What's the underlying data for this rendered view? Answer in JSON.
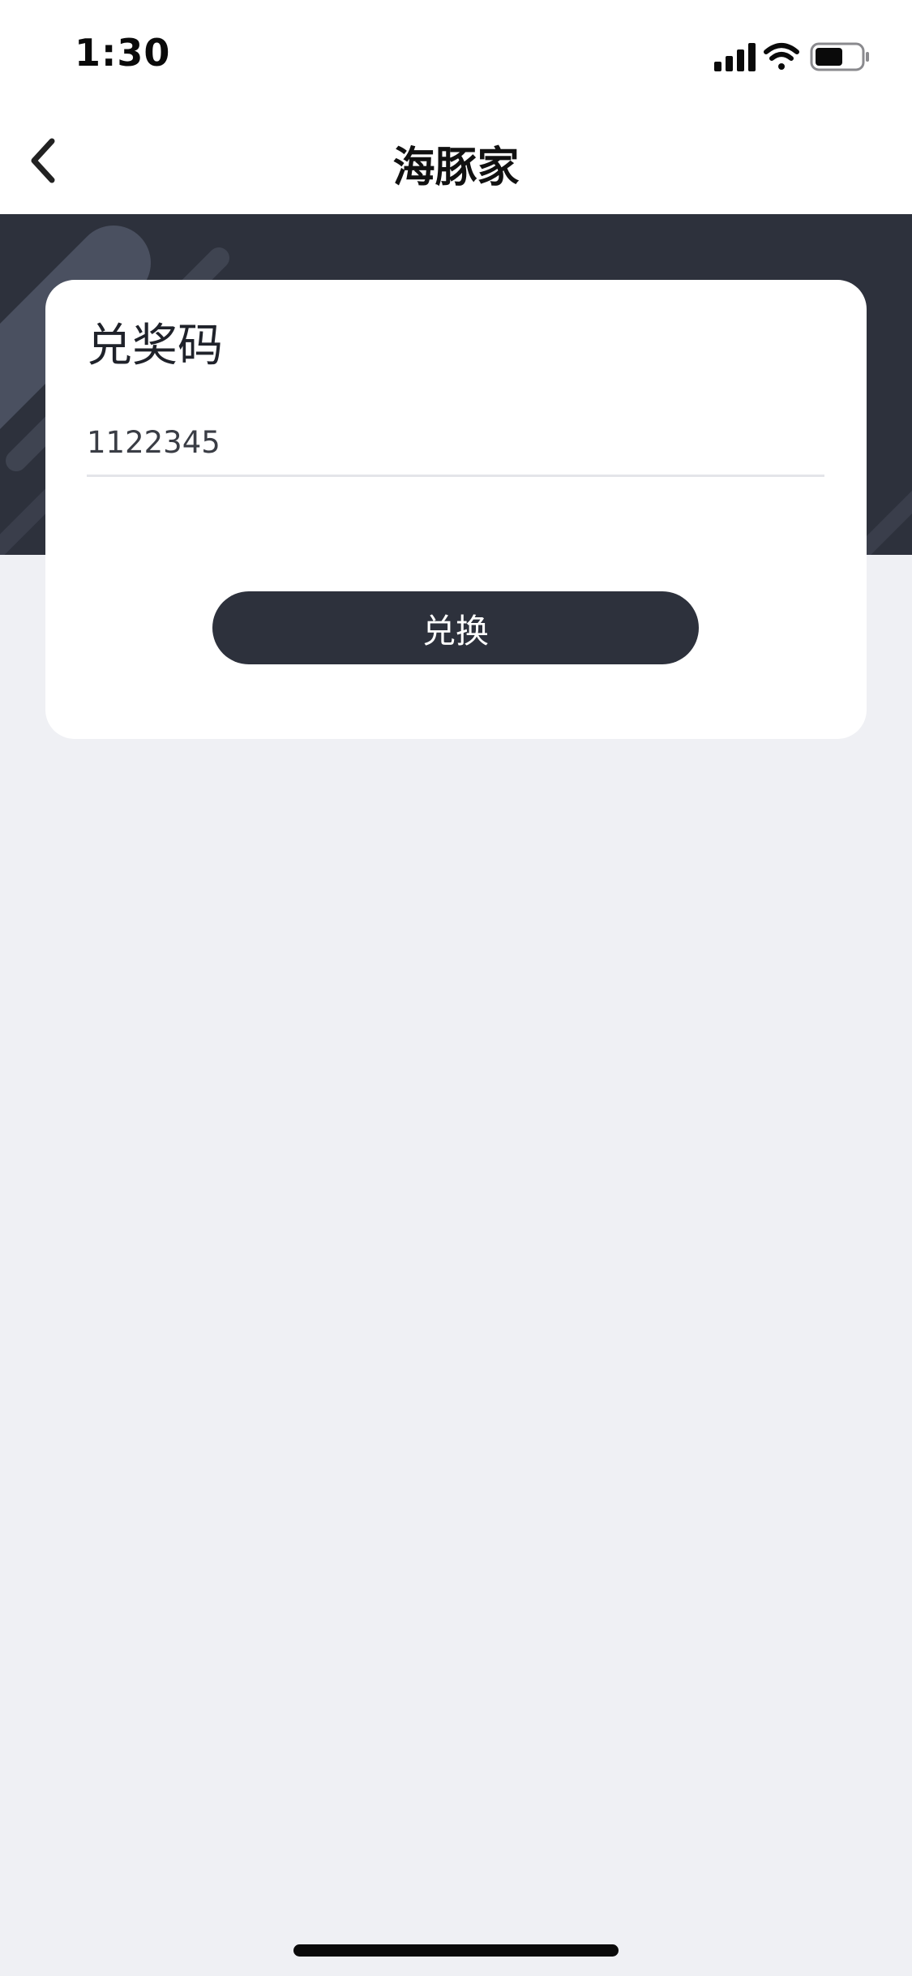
{
  "status_bar": {
    "time": "1:30",
    "icons": [
      "cellular-signal-icon",
      "wifi-icon",
      "battery-icon"
    ],
    "battery_level": 0.6
  },
  "nav": {
    "title": "海豚家",
    "back_icon": "chevron-left-icon"
  },
  "card": {
    "title": "兑奖码",
    "input_value": "1122345",
    "button_label": "兑换"
  },
  "colors": {
    "accent_dark": "#2d313c",
    "page_background": "#eff0f4",
    "card_background": "#ffffff"
  }
}
